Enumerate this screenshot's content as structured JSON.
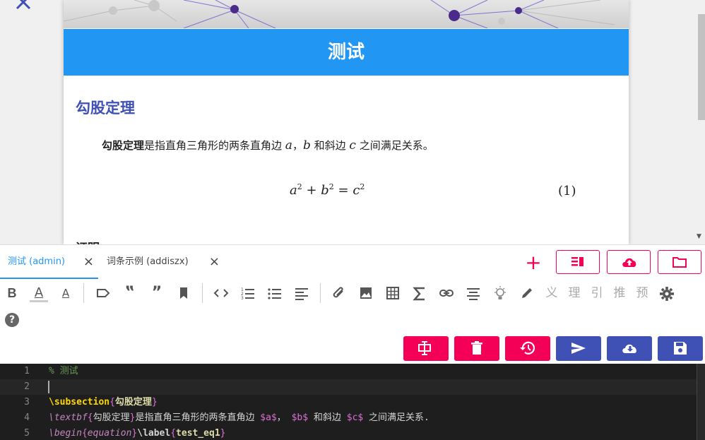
{
  "preview": {
    "title": "测试",
    "section_heading": "勾股定理",
    "paragraph": {
      "bold": "勾股定理",
      "text1": "是指直角三角形的两条直角边 ",
      "var_a": "a",
      "comma": "，",
      "var_b": "b",
      "text2": " 和斜边 ",
      "var_c": "c",
      "text3": " 之间满足关系。"
    },
    "equation": {
      "a": "a",
      "plus": " + ",
      "b": "b",
      "eq": " = ",
      "c": "c",
      "exp": "2"
    },
    "equation_number": "(1)",
    "next_heading": "证明"
  },
  "tabs": [
    {
      "label": "测试 (admin)",
      "close": "×"
    },
    {
      "label": "词条示例 (addiszx)",
      "close": "×"
    }
  ],
  "add_tab": "+",
  "toolbar_cjk": [
    "义",
    "理",
    "引",
    "推",
    "预"
  ],
  "toolbar_quotes": [
    "‟",
    "”"
  ],
  "help": "?",
  "colors": {
    "primary": "#2196f3",
    "accent": "#f50057",
    "indigo": "#3f51b5",
    "heading": "#3f51b5",
    "editor_bg": "#1e1e1e"
  },
  "code_lines": [
    {
      "num": "1"
    },
    {
      "num": "2"
    },
    {
      "num": "3"
    },
    {
      "num": "4"
    },
    {
      "num": "5"
    }
  ],
  "code": {
    "l1_comment": "% 测试",
    "l3_cmd": "\\subsection",
    "l3_ob": "{",
    "l3_arg": "勾股定理",
    "l3_cb": "}",
    "l4_cmd": "\\textbf",
    "l4_ob": "{",
    "l4_arg": "勾股定理",
    "l4_cb": "}",
    "l4_t1": "是指直角三角形的两条直角边 ",
    "l4_m1": "$a$",
    "l4_t2": "， ",
    "l4_m2": "$b$",
    "l4_t3": " 和斜边 ",
    "l4_m3": "$c$",
    "l4_t4": " 之间满足关系.",
    "l5_cmd1": "\\begin",
    "l5_ob1": "{",
    "l5_arg1": "equation",
    "l5_cb1": "}",
    "l5_cmd2": "\\label",
    "l5_ob2": "{",
    "l5_arg2": "test_eq1",
    "l5_cb2": "}"
  }
}
